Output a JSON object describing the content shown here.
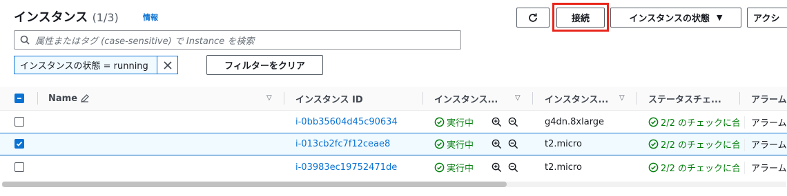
{
  "header": {
    "title": "インスタンス",
    "count": "(1/3)",
    "info": "情報"
  },
  "toolbar": {
    "connect_label": "接続",
    "state_label": "インスタンスの状態",
    "actions_label": "アクシ"
  },
  "search": {
    "placeholder": "属性またはタグ (case-sensitive) で Instance を検索"
  },
  "filter": {
    "token": "インスタンスの状態 = running",
    "clear_label": "フィルターをクリア"
  },
  "table": {
    "columns": {
      "name": "Name",
      "instance_id": "インスタンス ID",
      "state": "インスタンス...",
      "type": "インスタンス...",
      "status_check": "ステータスチェ...",
      "alarm": "アラーム"
    },
    "rows": [
      {
        "name": "",
        "instance_id": "i-0bb35604d45c90634",
        "state": "実行中",
        "type": "g4dn.8xlarge",
        "status_check": "2/2 のチェックに合",
        "alarm": "アラーム",
        "selected": false
      },
      {
        "name": "",
        "instance_id": "i-013cb2fc7f12ceae8",
        "state": "実行中",
        "type": "t2.micro",
        "status_check": "2/2 のチェックに合",
        "alarm": "アラーム",
        "selected": true
      },
      {
        "name": "",
        "instance_id": "i-03983ec19752471de",
        "state": "実行中",
        "type": "t2.micro",
        "status_check": "2/2 のチェックに合",
        "alarm": "アラーム",
        "selected": false
      }
    ]
  },
  "colors": {
    "link": "#0972d3",
    "success": "#037f0c",
    "highlight": "#e8251b"
  }
}
